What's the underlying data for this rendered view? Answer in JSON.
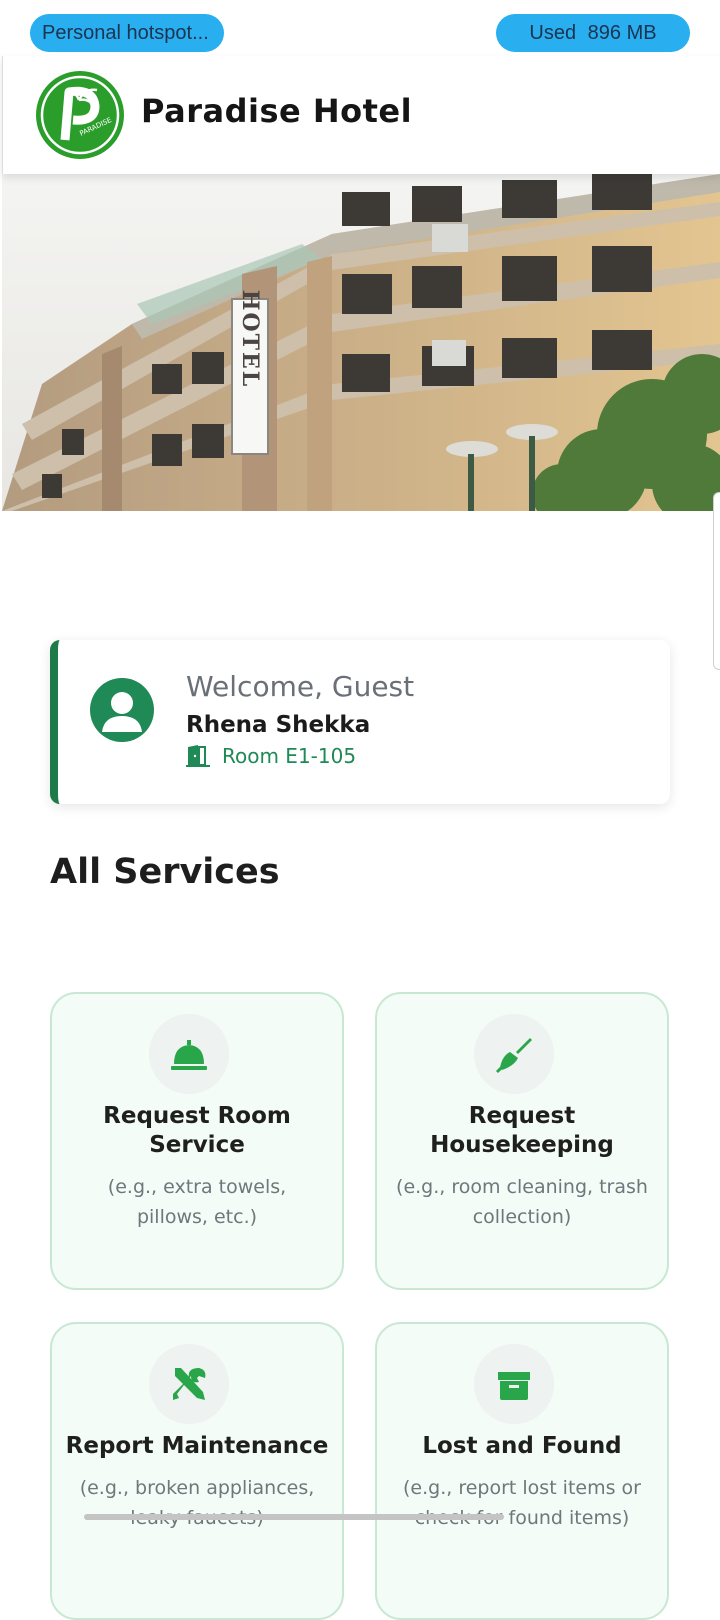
{
  "status_bar": {
    "hotspot_label": "Personal hotspot...",
    "data_used_label": "Used",
    "data_used_value": "896 MB"
  },
  "header": {
    "brand_name": "Paradise Hotel",
    "logo_text": "PARADISE"
  },
  "hero": {
    "sign_text": "HOTEL"
  },
  "welcome": {
    "greeting": "Welcome, Guest",
    "guest_name": "Rhena Shekka",
    "room": "Room E1-105"
  },
  "services": {
    "title": "All Services",
    "items": [
      {
        "title": "Request Room Service",
        "desc": "(e.g., extra towels, pillows, etc.)",
        "icon": "concierge-bell-icon"
      },
      {
        "title": "Request Housekeeping",
        "desc": "(e.g., room cleaning, trash collection)",
        "icon": "broom-icon"
      },
      {
        "title": "Report Maintenance",
        "desc": "(e.g., broken appliances, leaky faucets)",
        "icon": "tools-icon"
      },
      {
        "title": "Lost and Found",
        "desc": "(e.g., report lost items or check for found items)",
        "icon": "box-icon"
      }
    ]
  },
  "colors": {
    "accent_green": "#1f8a55",
    "status_pill": "#29aef0"
  }
}
